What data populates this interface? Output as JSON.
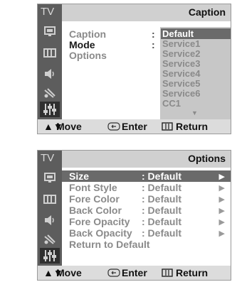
{
  "caption_menu": {
    "tv_label": "TV",
    "title": "Caption",
    "rows": [
      {
        "label": "Caption",
        "colon": ":"
      },
      {
        "label": "Mode",
        "colon": ":"
      },
      {
        "label": "Options",
        "colon": ""
      }
    ],
    "dropdown_options": [
      "Default",
      "Service1",
      "Service2",
      "Service3",
      "Service4",
      "Service5",
      "Service6",
      "CC1"
    ],
    "scroll_glyph": "▼",
    "footer": {
      "move": "Move",
      "enter": "Enter",
      "return": "Return"
    }
  },
  "options_menu": {
    "tv_label": "TV",
    "title": "Options",
    "rows": [
      {
        "label": "Size",
        "value": ": Default",
        "arrow": "▶"
      },
      {
        "label": "Font Style",
        "value": ": Default",
        "arrow": "▶"
      },
      {
        "label": "Fore Color",
        "value": ": Default",
        "arrow": "▶"
      },
      {
        "label": "Back Color",
        "value": ": Default",
        "arrow": "▶"
      },
      {
        "label": "Fore Opacity",
        "value": ": Default",
        "arrow": "▶"
      },
      {
        "label": "Back Opacity",
        "value": ": Default",
        "arrow": "▶"
      }
    ],
    "reset": "Return to Default",
    "footer": {
      "move": "Move",
      "enter": "Enter",
      "return": "Return"
    }
  },
  "icons": [
    "picture-icon",
    "sound-icon",
    "channel-icon",
    "setup-icon",
    "input-icon"
  ],
  "colors": {
    "sidebar": "#5d5d5d",
    "highlight": "#6a6a6a",
    "dim_text": "#8a8a8a",
    "title_bar": "#d0d0d0"
  }
}
